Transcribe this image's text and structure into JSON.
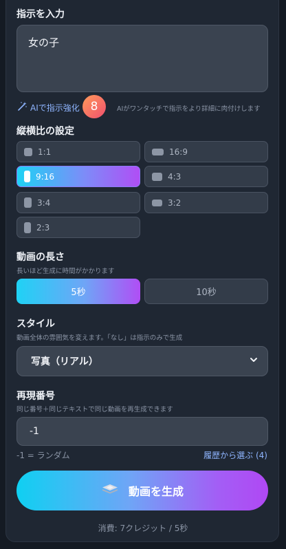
{
  "prompt": {
    "label": "指示を入力",
    "value": "女の子"
  },
  "enhance": {
    "label": "AIで指示強化",
    "badge": "8",
    "description": "AIがワンタッチで指示をより詳細に肉付けします"
  },
  "aspect": {
    "label": "縦横比の設定",
    "selected": "9:16",
    "options": [
      "1:1",
      "16:9",
      "9:16",
      "4:3",
      "3:4",
      "3:2",
      "2:3"
    ]
  },
  "duration": {
    "label": "動画の長さ",
    "hint": "長いほど生成に時間がかかります",
    "selected": "5秒",
    "options": [
      "5秒",
      "10秒"
    ]
  },
  "style": {
    "label": "スタイル",
    "hint": "動画全体の雰囲気を変えます。「なし」は指示のみで生成",
    "value": "写真（リアル）"
  },
  "seed": {
    "label": "再現番号",
    "hint": "同じ番号＋同じテキストで同じ動画を再生成できます",
    "value": "-1",
    "random_note": "-1 = ランダム",
    "history_link": "履歴から選ぶ (4)"
  },
  "generate": {
    "label": "動画を生成",
    "cost": "消費: 7クレジット / 5秒"
  },
  "colors": {
    "accent_start": "#0fd0f2",
    "accent_end": "#b048f4",
    "badge": "#f0506e",
    "link": "#8fb5ff"
  },
  "icons": {
    "enhance": "magic-wand-icon",
    "generate": "video-stack-icon",
    "select": "chevron-down-icon"
  }
}
